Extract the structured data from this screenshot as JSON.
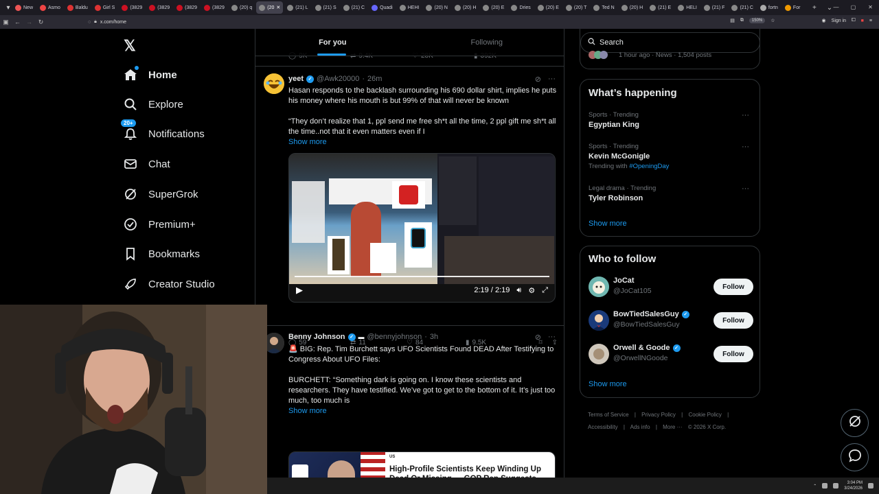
{
  "browser": {
    "tabs": [
      {
        "label": "New",
        "fav": "#e55"
      },
      {
        "label": "Asmo",
        "fav": "#e44"
      },
      {
        "label": "Baldu",
        "fav": "#d33"
      },
      {
        "label": "Girl S",
        "fav": "#d33"
      },
      {
        "label": "(3829",
        "fav": "#c12"
      },
      {
        "label": "(3829",
        "fav": "#c12"
      },
      {
        "label": "(3829",
        "fav": "#c12"
      },
      {
        "label": "(3829",
        "fav": "#c12"
      },
      {
        "label": "(20) q",
        "fav": "#888"
      },
      {
        "label": "(20",
        "fav": "#888",
        "active": true
      },
      {
        "label": "(21) L",
        "fav": "#888"
      },
      {
        "label": "(21) S",
        "fav": "#888"
      },
      {
        "label": "(21) C",
        "fav": "#888"
      },
      {
        "label": "Quadi",
        "fav": "#66f"
      },
      {
        "label": "HEHI",
        "fav": "#888"
      },
      {
        "label": "(20) N",
        "fav": "#888"
      },
      {
        "label": "(20) H",
        "fav": "#888"
      },
      {
        "label": "(20) E",
        "fav": "#888"
      },
      {
        "label": "Dries",
        "fav": "#888"
      },
      {
        "label": "(20) E",
        "fav": "#888"
      },
      {
        "label": "(20) T",
        "fav": "#888"
      },
      {
        "label": "Ted N",
        "fav": "#888"
      },
      {
        "label": "(20) H",
        "fav": "#888"
      },
      {
        "label": "(21) E",
        "fav": "#888"
      },
      {
        "label": "HELI",
        "fav": "#888"
      },
      {
        "label": "(21) F",
        "fav": "#888"
      },
      {
        "label": "(21) C",
        "fav": "#888"
      },
      {
        "label": "fortn",
        "fav": "#aaa"
      },
      {
        "label": "For",
        "fav": "#e90"
      }
    ],
    "url": "x.com/home",
    "zoom": "150%",
    "sign_in": "Sign in"
  },
  "nav": {
    "items": [
      {
        "label": "Home",
        "icon": "home-icon"
      },
      {
        "label": "Explore",
        "icon": "search-icon"
      },
      {
        "label": "Notifications",
        "icon": "bell-icon",
        "badge": "20+"
      },
      {
        "label": "Chat",
        "icon": "mail-icon"
      },
      {
        "label": "SuperGrok",
        "icon": "grok-icon"
      },
      {
        "label": "Premium+",
        "icon": "verified-icon"
      },
      {
        "label": "Bookmarks",
        "icon": "bookmark-icon"
      },
      {
        "label": "Creator Studio",
        "icon": "rocket-icon"
      }
    ]
  },
  "feed": {
    "tabs": [
      "For you",
      "Following"
    ],
    "prev_stats": {
      "replies": "9K",
      "reposts": "9.4K",
      "likes": "28K",
      "views": "392K"
    },
    "tweet1": {
      "name": "yeet",
      "handle": "@Awk20000",
      "time": "26m",
      "text1": "Hasan responds to the backlash surrounding his 690 dollar shirt, implies he puts his money where his mouth is but 99% of that will never be known",
      "text2": "“They don’t realize that 1, ppl send me free sh*t all the time, 2 ppl gift me sh*t all the time..not that it even matters even if I",
      "show_more": "Show more",
      "video_time": "2:19 / 2:19",
      "replies": "59",
      "reposts": "11",
      "likes": "84",
      "views": "9.5K"
    },
    "tweet2": {
      "name": "Benny Johnson",
      "handle": "@bennyjohnson",
      "time": "3h",
      "text1": "🚨 BIG: Rep. Tim Burchett says UFO Scientists Found DEAD After Testifying to Congress About UFO Files:",
      "text2": "BURCHETT: “Something dark is going on. I know these scientists and researchers. They have testified. We’ve got to get to the bottom of it.  It’s just too much, too much is",
      "show_more": "Show more",
      "card_kicker": "US",
      "card_title": "High-Profile Scientists Keep Winding Up Dead Or Missing — GOP Rep Suggests There May Be A Conspiracy At Play"
    }
  },
  "right": {
    "search_placeholder": "Search",
    "top_fragment": "1 hour ago · News · 1,504 posts",
    "happening_title": "What’s happening",
    "trends": [
      {
        "meta": "Sports · Trending",
        "title": "Egyptian King",
        "sub": ""
      },
      {
        "meta": "Sports · Trending",
        "title": "Kevin McGonigle",
        "sub": "Trending with",
        "hashtag": "#OpeningDay"
      },
      {
        "meta": "Legal drama · Trending",
        "title": "Tyler Robinson",
        "sub": ""
      }
    ],
    "show_more": "Show more",
    "wtf_title": "Who to follow",
    "follow": [
      {
        "name": "JoCat",
        "handle": "@JoCat105",
        "verified": false
      },
      {
        "name": "BowTiedSalesGuy",
        "handle": "@BowTiedSalesGuy",
        "verified": true
      },
      {
        "name": "Orwell & Goode",
        "handle": "@OrwellNGoode",
        "verified": true
      }
    ],
    "follow_label": "Follow",
    "footer": [
      "Terms of Service",
      "|",
      "Privacy Policy",
      "|",
      "Cookie Policy",
      "|",
      "Accessibility",
      "|",
      "Ads info",
      "|",
      "More ···",
      "© 2026 X Corp."
    ]
  },
  "taskbar": {
    "time": "3:04 PM",
    "date": "3/24/2026"
  }
}
